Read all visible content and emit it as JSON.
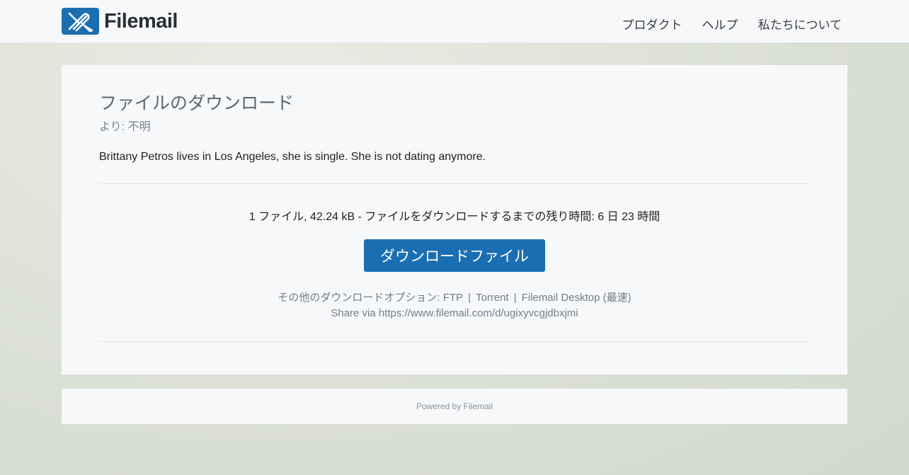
{
  "header": {
    "logo_text": "Filemail",
    "nav": [
      "プロダクト",
      "ヘルプ",
      "私たちについて"
    ]
  },
  "card": {
    "title": "ファイルのダウンロード",
    "from": "より: 不明",
    "message": "Brittany Petros lives in Los Angeles, she is single. She is not dating anymore.",
    "file_info": "1 ファイル, 42.24 kB - ファイルをダウンロードするまでの残り時間: 6 日 23 時間",
    "download_button": "ダウンロードファイル",
    "options_label": "その他のダウンロードオプション:",
    "option_ftp": "FTP",
    "option_torrent": "Torrent",
    "option_desktop": "Filemail Desktop (最速)",
    "separator": "|",
    "share_text": "Share via https://www.filemail.com/d/ugixyvcgjdbxjmi"
  },
  "footer": {
    "powered_by": "Powered by Filemail"
  },
  "colors": {
    "brand": "#1a6fb3",
    "card_bg": "#f6f8fa"
  }
}
